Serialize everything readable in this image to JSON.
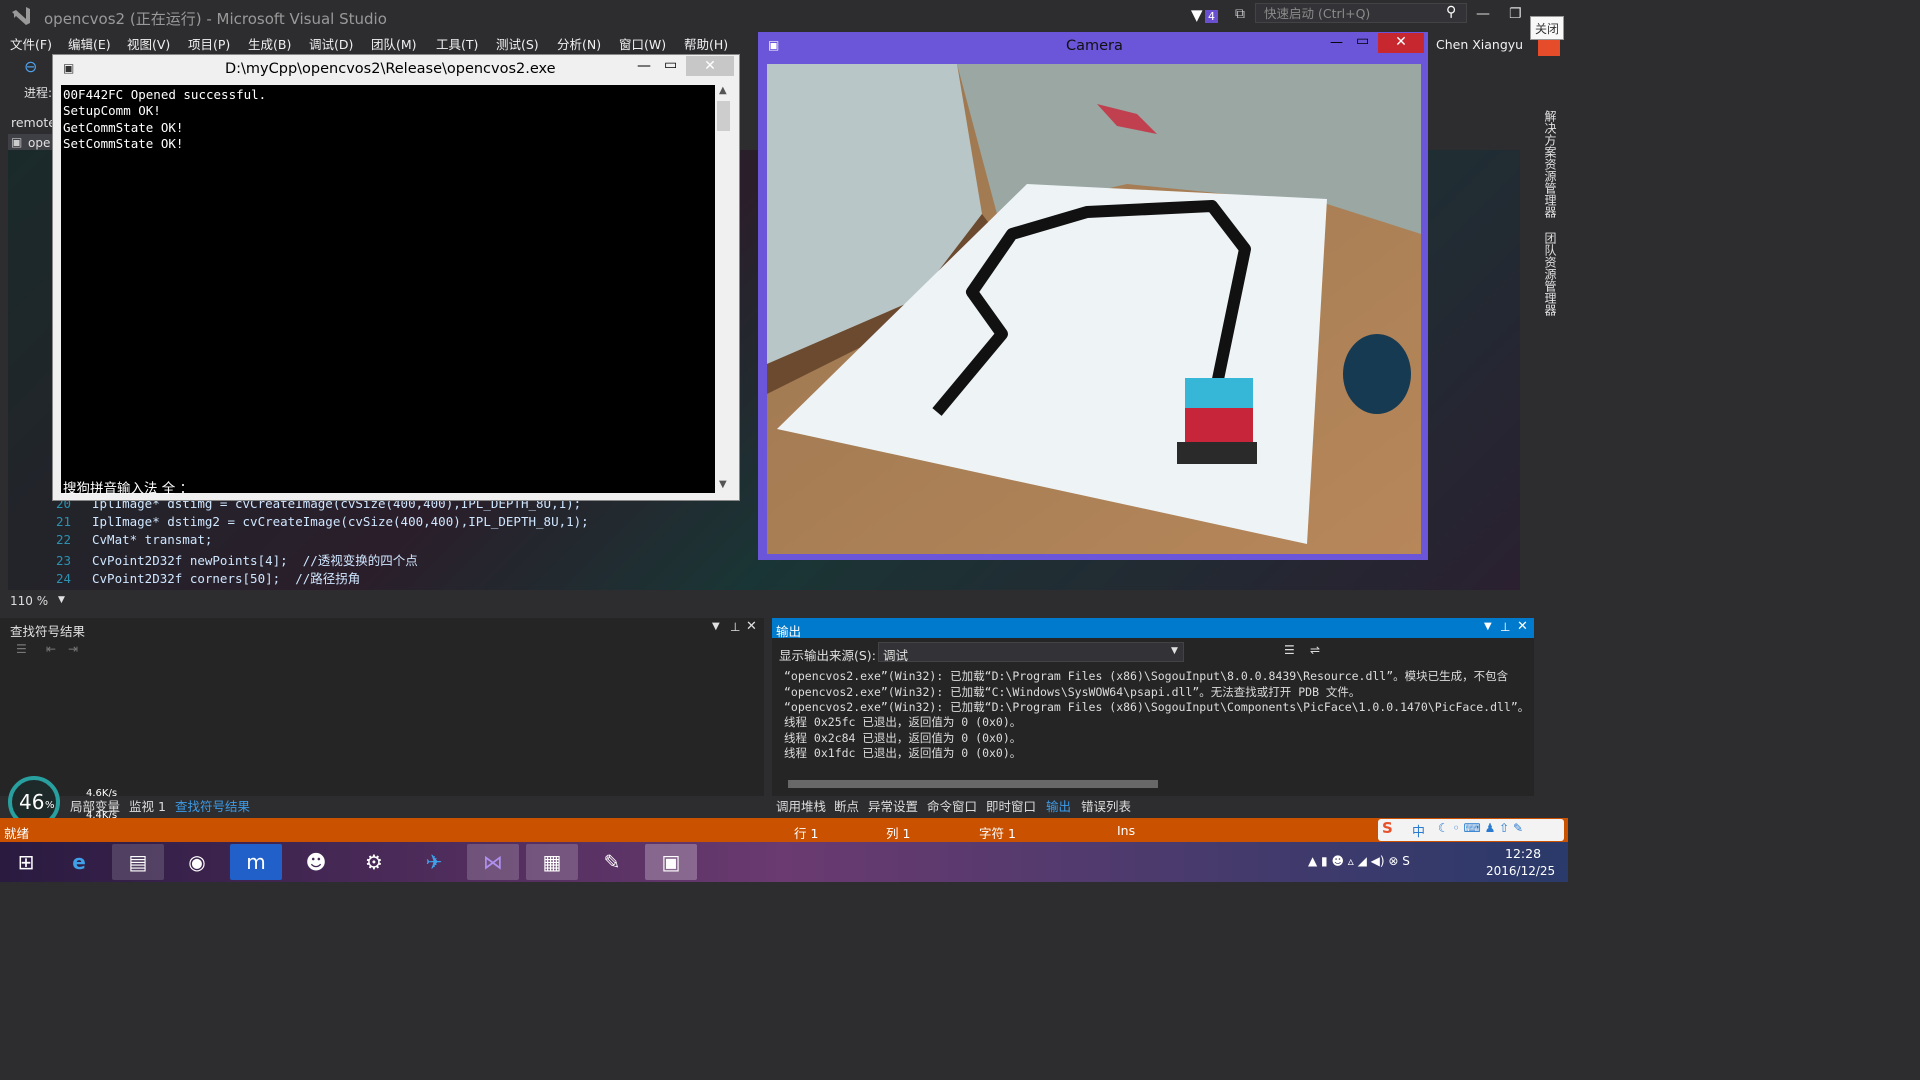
{
  "vs": {
    "title": "opencvos2 (正在运行) - Microsoft Visual Studio",
    "menu": [
      "文件(F)",
      "编辑(E)",
      "视图(V)",
      "项目(P)",
      "生成(B)",
      "调试(D)",
      "团队(M)",
      "工具(T)",
      "测试(S)",
      "分析(N)",
      "窗口(W)",
      "帮助(H)"
    ],
    "notification_count": "4",
    "quick_launch_placeholder": "快速启动 (Ctrl+Q)",
    "user": "Chen Xiangyu",
    "close_tooltip": "关闭",
    "progress_label": "进程:",
    "remote_label": "remote",
    "file_tab": "ope",
    "zoom": "110 %",
    "side_tabs": [
      "解决方案资源管理器",
      "团队资源管理器"
    ]
  },
  "code": [
    {
      "ln": "20",
      "text": "IplImage* dstimg = cvCreateImage(cvSize(400,400),IPL_DEPTH_8U,1);"
    },
    {
      "ln": "21",
      "text": "IplImage* dstimg2 = cvCreateImage(cvSize(400,400),IPL_DEPTH_8U,1);"
    },
    {
      "ln": "22",
      "text": "CvMat* transmat;"
    },
    {
      "ln": "23",
      "text": "CvPoint2D32f newPoints[4];  //透视变换的四个点"
    },
    {
      "ln": "24",
      "text": "CvPoint2D32f corners[50];  //路径拐角"
    }
  ],
  "console": {
    "title": "D:\\myCpp\\opencvos2\\Release\\opencvos2.exe",
    "lines": [
      "00F442FC Opened successful.",
      "SetupComm OK!",
      "GetCommState OK!",
      "SetCommState OK!"
    ],
    "ime": "搜狗拼音输入法 全 ："
  },
  "camera": {
    "title": "Camera"
  },
  "find_panel": {
    "title": "查找符号结果"
  },
  "output_panel": {
    "title": "输出",
    "source_label": "显示输出来源(S):",
    "source_value": "调试",
    "lines": [
      "“opencvos2.exe”(Win32): 已加载“D:\\Program Files (x86)\\SogouInput\\8.0.0.8439\\Resource.dll”。模块已生成，不包含",
      "“opencvos2.exe”(Win32): 已加载“C:\\Windows\\SysWOW64\\psapi.dll”。无法查找或打开 PDB 文件。",
      "“opencvos2.exe”(Win32): 已加载“D:\\Program Files (x86)\\SogouInput\\Components\\PicFace\\1.0.0.1470\\PicFace.dll”。",
      "线程 0x25fc 已退出，返回值为 0 (0x0)。",
      "线程 0x2c84 已退出，返回值为 0 (0x0)。",
      "线程 0x1fdc 已退出，返回值为 0 (0x0)。"
    ]
  },
  "bottom_tabs_left": [
    "局部变量",
    "监视 1",
    "查找符号结果"
  ],
  "bottom_tabs_right": [
    "调用堆栈",
    "断点",
    "异常设置",
    "命令窗口",
    "即时窗口",
    "输出",
    "错误列表"
  ],
  "net_widget": {
    "percent": "46",
    "unit": "%",
    "up": "4.6K/s",
    "down": "4.4K/s"
  },
  "status": {
    "ready": "就绪",
    "row": "行 1",
    "col": "列 1",
    "char": "字符 1",
    "mode": "Ins"
  },
  "tray": {
    "ime": "中",
    "time": "12:28",
    "date": "2016/12/25"
  }
}
